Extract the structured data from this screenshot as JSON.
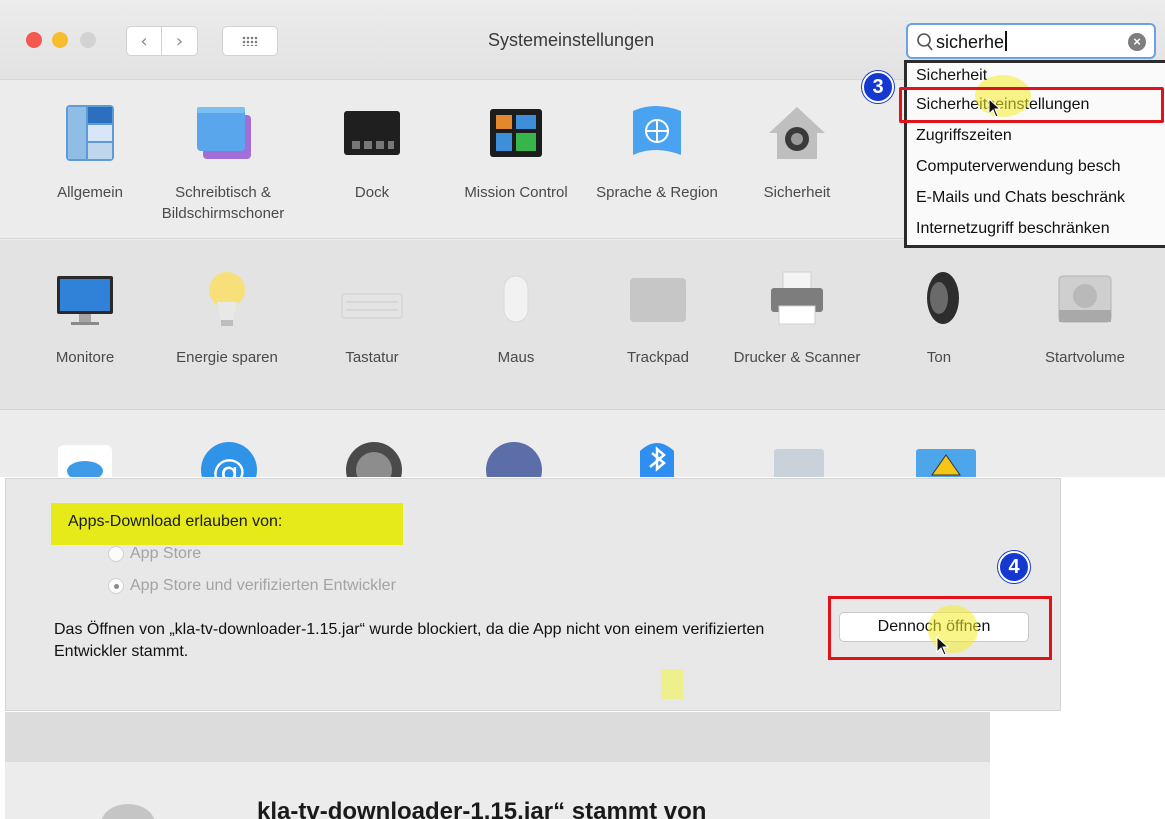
{
  "window": {
    "title": "Systemeinstellungen"
  },
  "search": {
    "value": "sicherhe"
  },
  "dropdown": {
    "items": [
      "Sicherheit",
      "Sicherheitseinstellungen",
      "Zugriffszeiten",
      "Computerverwendung besch",
      "E-Mails und Chats beschränk",
      "Internetzugriff beschränken"
    ]
  },
  "badges": {
    "step3": "3",
    "step4": "4"
  },
  "prefs": {
    "row1": [
      "Allgemein",
      "Schreibtisch & Bildschirmschoner",
      "Dock",
      "Mission Control",
      "Sprache & Region",
      "Sicherheit"
    ],
    "row2": [
      "Monitore",
      "Energie sparen",
      "Tastatur",
      "Maus",
      "Trackpad",
      "Drucker & Scanner",
      "Ton",
      "Startvolume"
    ]
  },
  "security": {
    "allow_label": "Apps-Download erlauben von:",
    "option_app_store": "App Store",
    "option_identified": "App Store und verifizierten Entwickler",
    "blocked_message": "Das Öffnen von „kla-tv-downloader-1.15.jar“ wurde blockiert, da die App nicht von einem verifizierten Entwickler stammt.",
    "open_anyway": "Dennoch öffnen"
  },
  "dialog": {
    "heading": "kla-tv-downloader-1.15.jar“ stammt von"
  },
  "colors": {
    "annotation_red": "#e0121a",
    "badge_blue": "#1538d1",
    "highlight_yellow": "#e6ea19"
  }
}
